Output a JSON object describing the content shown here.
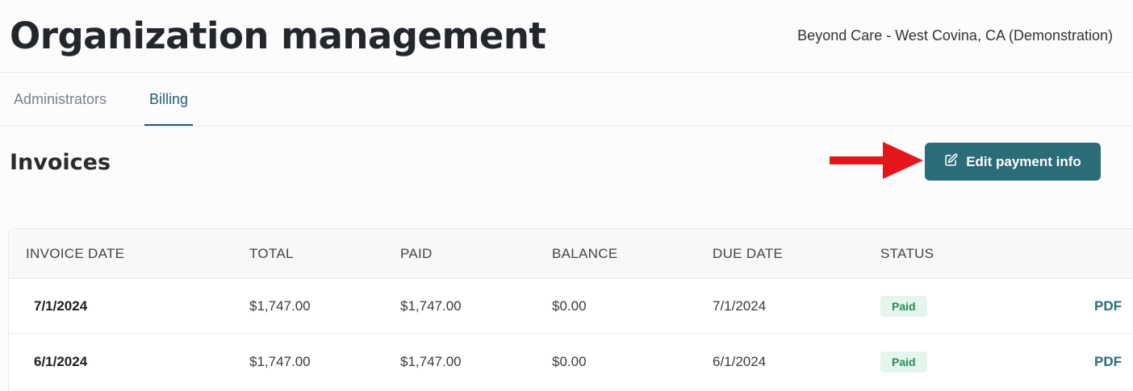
{
  "header": {
    "title": "Organization management",
    "organization": "Beyond Care - West Covina, CA (Demonstration)"
  },
  "tabs": [
    {
      "label": "Administrators",
      "active": false
    },
    {
      "label": "Billing",
      "active": true
    }
  ],
  "invoices": {
    "title": "Invoices",
    "edit_button_label": "Edit payment info",
    "edit_button_icon": "edit-icon",
    "columns": [
      "INVOICE DATE",
      "TOTAL",
      "PAID",
      "BALANCE",
      "DUE DATE",
      "STATUS"
    ],
    "rows": [
      {
        "invoice_date": "7/1/2024",
        "total": "$1,747.00",
        "paid": "$1,747.00",
        "balance": "$0.00",
        "due_date": "7/1/2024",
        "status": "Paid",
        "link": "PDF"
      },
      {
        "invoice_date": "6/1/2024",
        "total": "$1,747.00",
        "paid": "$1,747.00",
        "balance": "$0.00",
        "due_date": "6/1/2024",
        "status": "Paid",
        "link": "PDF"
      }
    ]
  },
  "colors": {
    "accent": "#2a6c78",
    "active_tab": "#1f5f6e",
    "paid_badge_bg": "#e3f5ec",
    "paid_badge_text": "#2c8a5a",
    "annotation_arrow": "#e3161b"
  }
}
